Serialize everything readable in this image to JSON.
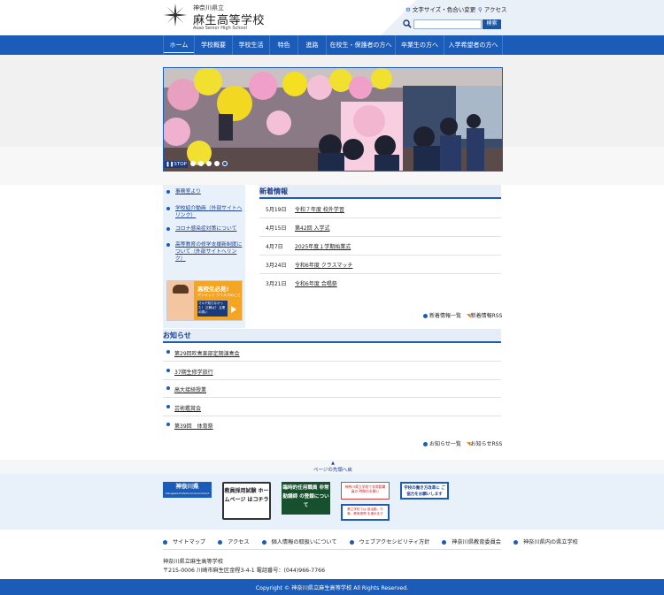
{
  "header": {
    "prefecture": "神奈川県立",
    "school_name": "麻生高等学校",
    "school_name_en": "Asao Senior High School",
    "fontsize_link": "文字サイズ・色合い変更",
    "access_link": "アクセス",
    "search_placeholder": "",
    "search_button": "検索"
  },
  "nav": {
    "items": [
      {
        "label": "ホーム"
      },
      {
        "label": "学校概要"
      },
      {
        "label": "学校生活"
      },
      {
        "label": "特色"
      },
      {
        "label": "進路"
      },
      {
        "label": "在校生・保護者の方へ"
      },
      {
        "label": "卒業生の方へ"
      },
      {
        "label": "入学希望者の方へ"
      }
    ]
  },
  "slider": {
    "stop_label": "STOP",
    "slide_count": 5,
    "active_slide": 5
  },
  "sidebar": {
    "links": [
      {
        "label": "事務室より"
      },
      {
        "label": "学校紹介動画（外部サイトへリンク）"
      },
      {
        "label": "コロナ感染症対策について"
      },
      {
        "label": "高等教育の修学支援新制度について（外部サイトへリンク）"
      }
    ],
    "banner_title": "高校生必見!",
    "banner_sub": "アンメット フイルスのこと",
    "banner_body": "マルチ知らなかった！ 正解は？ 企業の誘い"
  },
  "news": {
    "heading": "新着情報",
    "items": [
      {
        "date": "5月19日",
        "title": "令和７年度 校外学習"
      },
      {
        "date": "4月15日",
        "title": "第42回 入学式"
      },
      {
        "date": "4月7日",
        "title": "2025年度１学期始業式"
      },
      {
        "date": "3月24日",
        "title": "令和6年度 クラスマッチ"
      },
      {
        "date": "3月21日",
        "title": "令和6年度 合唱祭"
      }
    ],
    "list_link": "新着情報一覧",
    "rss_link": "新着情報RSS"
  },
  "notice": {
    "heading": "お知らせ",
    "items": [
      {
        "title": "第29回吹奏楽部定期演奏会"
      },
      {
        "title": "37期生修学旅行"
      },
      {
        "title": "高大接続授業"
      },
      {
        "title": "芸術鑑賞会"
      },
      {
        "title": "第39回　体育祭"
      }
    ],
    "list_link": "お知らせ一覧",
    "rss_link": "お知らせRSS"
  },
  "pagetop": "ページの先頭へ戻る",
  "footer_banners": {
    "kanagawa": "神奈川県",
    "kanagawa_sub": "Kanagawa Prefectural Government",
    "exam": "教員採用試験 ホームページ はコチラ",
    "temp_staff": "臨時的任用職員 非常勤講師 の登録について",
    "recruit": "神奈川県立学校で非常勤職員の 時間のお願い",
    "work_reform": "学校の働き方改革に ご協力をお願いします",
    "support": "県立学校では 部活動、行事、教育振興 を進めます"
  },
  "footer": {
    "links": [
      {
        "label": "サイトマップ"
      },
      {
        "label": "アクセス"
      },
      {
        "label": "個人情報の取扱いについて"
      },
      {
        "label": "ウェブアクセシビリティ方針"
      },
      {
        "label": "神奈川県教育委員会"
      },
      {
        "label": "神奈川県内の県立学校"
      }
    ],
    "school_name": "神奈川県立麻生高等学校",
    "address": "〒215-0006 川崎市麻生区金程3-4-1  電話番号：(044)966-7766",
    "copyright": "Copyright © 神奈川県立麻生高等学校 All Rights Reserved."
  },
  "colors": {
    "primary": "#1b5cb8",
    "light_bg": "#e8f0fa",
    "heading_text": "#1a3e90"
  }
}
